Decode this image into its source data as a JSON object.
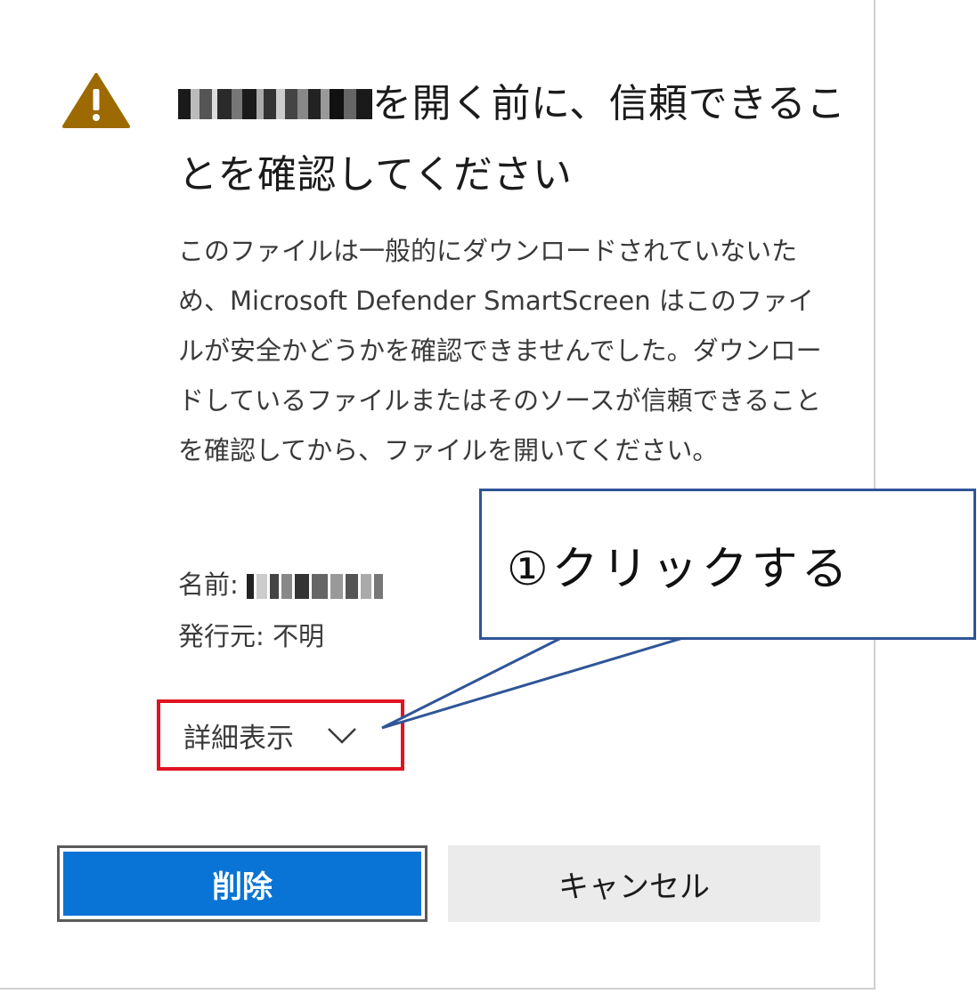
{
  "dialog": {
    "title_suffix": "を開く前に、信頼できることを確認してください",
    "description": "このファイルは一般的にダウンロードされていないため、Microsoft Defender SmartScreen はこのファイルが安全かどうかを確認できませんでした。ダウンロードしているファイルまたはそのソースが信頼できることを確認してから、ファイルを開いてください。",
    "name_label": "名前:",
    "publisher_label": "発行元:",
    "publisher_value": "不明",
    "details_label": "詳細表示",
    "delete_label": "削除",
    "cancel_label": "キャンセル",
    "icons": {
      "warning": "warning-icon",
      "chevron": "chevron-down-icon"
    }
  },
  "annotation": {
    "callout_text": "①クリックする"
  },
  "colors": {
    "primary_button": "#0a74d6",
    "warning_icon": "#9c6a00",
    "highlight_border": "#e01421",
    "callout_border": "#2f5597"
  }
}
